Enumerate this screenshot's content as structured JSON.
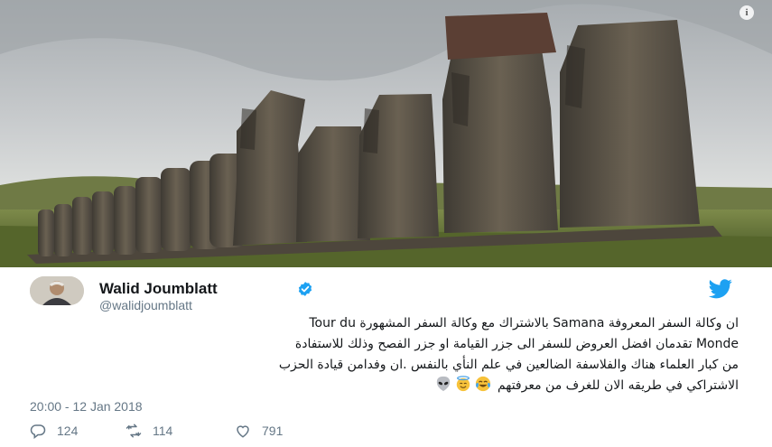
{
  "tweet": {
    "author_name": "Walid Joumblatt",
    "author_handle": "@walidjoumblatt",
    "text_lines": [
      "ان وكالة السفر المعروفة Samana بالاشتراك مع وكالة السفر المشهورة  Tour du",
      "Monde تقدمان  افضل العروض للسفر الى جزر القيامة او جزر الفصح وذلك للاستفادة",
      "من كبار العلماء هناك والفلاسفة الضالعين في علم النأي بالنفس .ان وفدامن قيادة الحزب",
      "الاشتراكي في طريقه الان للغرف من معرفتهم"
    ],
    "emojis": [
      "alien-icon",
      "smiling-face-with-halo-icon",
      "face-with-tears-of-joy-icon"
    ],
    "timestamp": "20:00 - 12 Jan 2018",
    "replies": "124",
    "retweets": "114",
    "likes": "791"
  },
  "colors": {
    "accent": "#1da1f2",
    "text": "#14171a",
    "muted": "#657786"
  }
}
